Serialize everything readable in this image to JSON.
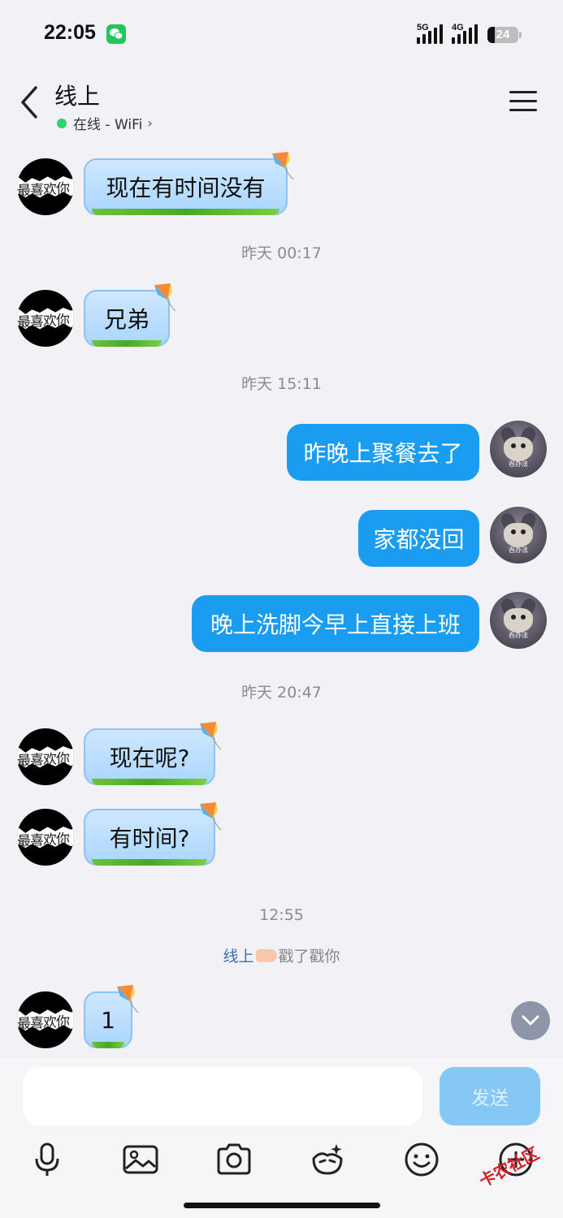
{
  "status_bar": {
    "time": "22:05",
    "network_1": "5G",
    "network_2": "4G",
    "battery": "24",
    "battery_level": 0.24
  },
  "header": {
    "title": "线上",
    "presence": "在线 - WiFi"
  },
  "messages": {
    "m1": "现在有时间没有",
    "t1": "昨天 00:17",
    "m2": "兄弟",
    "t2": "昨天 15:11",
    "o1": "昨晚上聚餐去了",
    "o2": "家都没回",
    "o3": "晚上洗脚今早上直接上班",
    "t3": "昨天 20:47",
    "m3": "现在呢?",
    "m4": "有时间?",
    "t4": "12:55",
    "poke_name": "线上",
    "poke_text": "戳了戳你",
    "m5": "1"
  },
  "avatar_text": "最喜欢你",
  "avatar_tom_caption": "吞办法",
  "input": {
    "send_label": "发送",
    "placeholder": ""
  },
  "watermark": "卡农社区",
  "colors": {
    "outgoing_bubble": "#1a9cf0",
    "send_button": "#86c8f5",
    "online_dot": "#2ed36d"
  }
}
